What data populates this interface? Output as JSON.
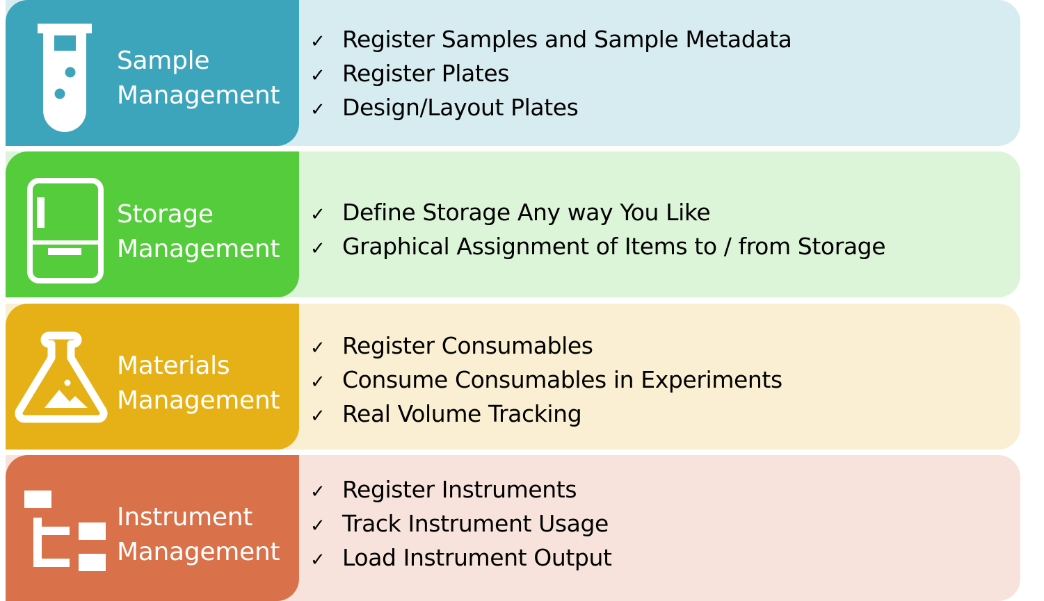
{
  "sections": [
    {
      "id": "sample",
      "title_line1": "Sample",
      "title_line2": "Management",
      "icon": "test-tube-icon",
      "accent_color": "#3da5bb",
      "panel_color": "#d7ecf1",
      "items": [
        {
          "label": "Register Samples and Sample Metadata"
        },
        {
          "label": "Register Plates"
        },
        {
          "label": "Design/Layout Plates"
        }
      ]
    },
    {
      "id": "storage",
      "title_line1": "Storage",
      "title_line2": "Management",
      "icon": "refrigerator-icon",
      "accent_color": "#55cc3b",
      "panel_color": "#dcf4d8",
      "items": [
        {
          "label": "Define Storage Any way You Like"
        },
        {
          "label": "Graphical Assignment of Items to / from Storage"
        }
      ]
    },
    {
      "id": "materials",
      "title_line1": "Materials",
      "title_line2": "Management",
      "icon": "flask-icon",
      "accent_color": "#e6b116",
      "panel_color": "#faefd2",
      "items": [
        {
          "label": "Register Consumables"
        },
        {
          "label": "Consume Consumables in Experiments"
        },
        {
          "label": "Real Volume Tracking"
        }
      ]
    },
    {
      "id": "instrument",
      "title_line1": "Instrument",
      "title_line2": "Management",
      "icon": "hierarchy-icon",
      "accent_color": "#d9714a",
      "panel_color": "#f7e3db",
      "items": [
        {
          "label": "Register Instruments"
        },
        {
          "label": "Track Instrument Usage"
        },
        {
          "label": "Load Instrument Output"
        }
      ]
    }
  ],
  "check_glyph": "✓"
}
